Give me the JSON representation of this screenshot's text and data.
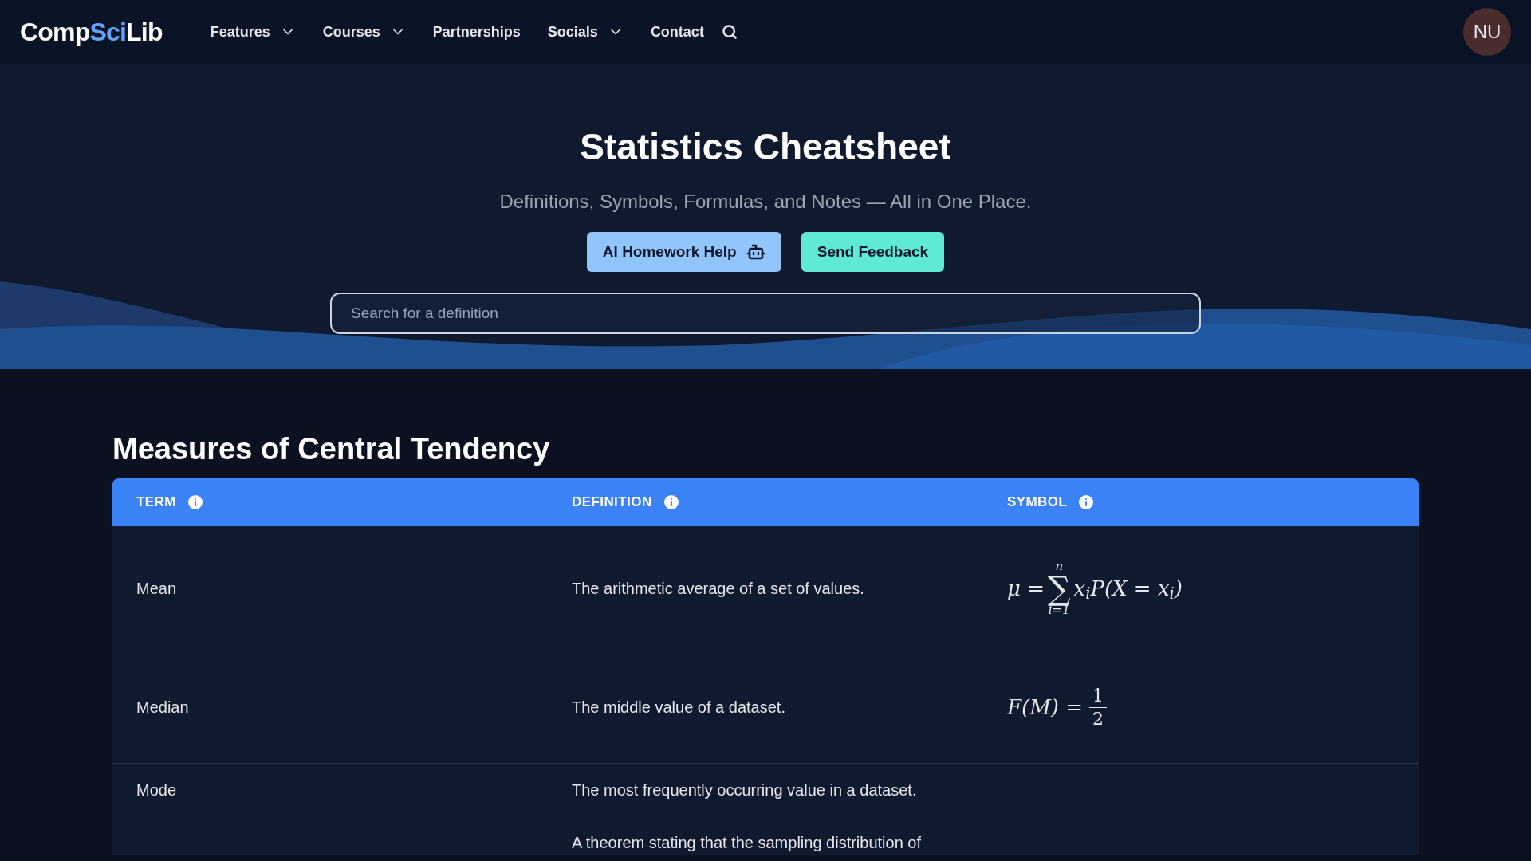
{
  "nav": {
    "logo": {
      "start": "Comp",
      "accent": "Sci",
      "end": "Lib"
    },
    "items": [
      {
        "label": "Features",
        "dropdown": true
      },
      {
        "label": "Courses",
        "dropdown": true
      },
      {
        "label": "Partnerships",
        "dropdown": false
      },
      {
        "label": "Socials",
        "dropdown": true
      },
      {
        "label": "Contact",
        "dropdown": false
      }
    ],
    "avatar": "NU"
  },
  "hero": {
    "title": "Statistics Cheatsheet",
    "subtitle": "Definitions, Symbols, Formulas, and Notes — All in One Place.",
    "buttons": [
      {
        "label": "AI Homework Help",
        "kind": "ai"
      },
      {
        "label": "Send Feedback",
        "kind": "feedback"
      }
    ],
    "search": {
      "placeholder": "Search for a definition"
    }
  },
  "section": {
    "title": "Measures of Central Tendency",
    "columns": [
      "TERM",
      "DEFINITION",
      "SYMBOL"
    ],
    "rows": [
      {
        "term": "Mean",
        "definition": "The arithmetic average of a set of values.",
        "symbol": {
          "kind": "sum",
          "lhs": "μ =",
          "operator": "∑",
          "upper": "n",
          "lower": "i=1",
          "body": "x$_{i}$P(X = x$_{i}$)"
        }
      },
      {
        "term": "Median",
        "definition": "The middle value of a dataset.",
        "symbol": {
          "kind": "fraction",
          "lhs": "F(M) =",
          "numerator": "1",
          "denominator": "2"
        }
      },
      {
        "term": "Mode",
        "definition": "The most frequently occurring value in a dataset."
      },
      {
        "definition": "A theorem stating that the sampling distribution of"
      }
    ]
  }
}
